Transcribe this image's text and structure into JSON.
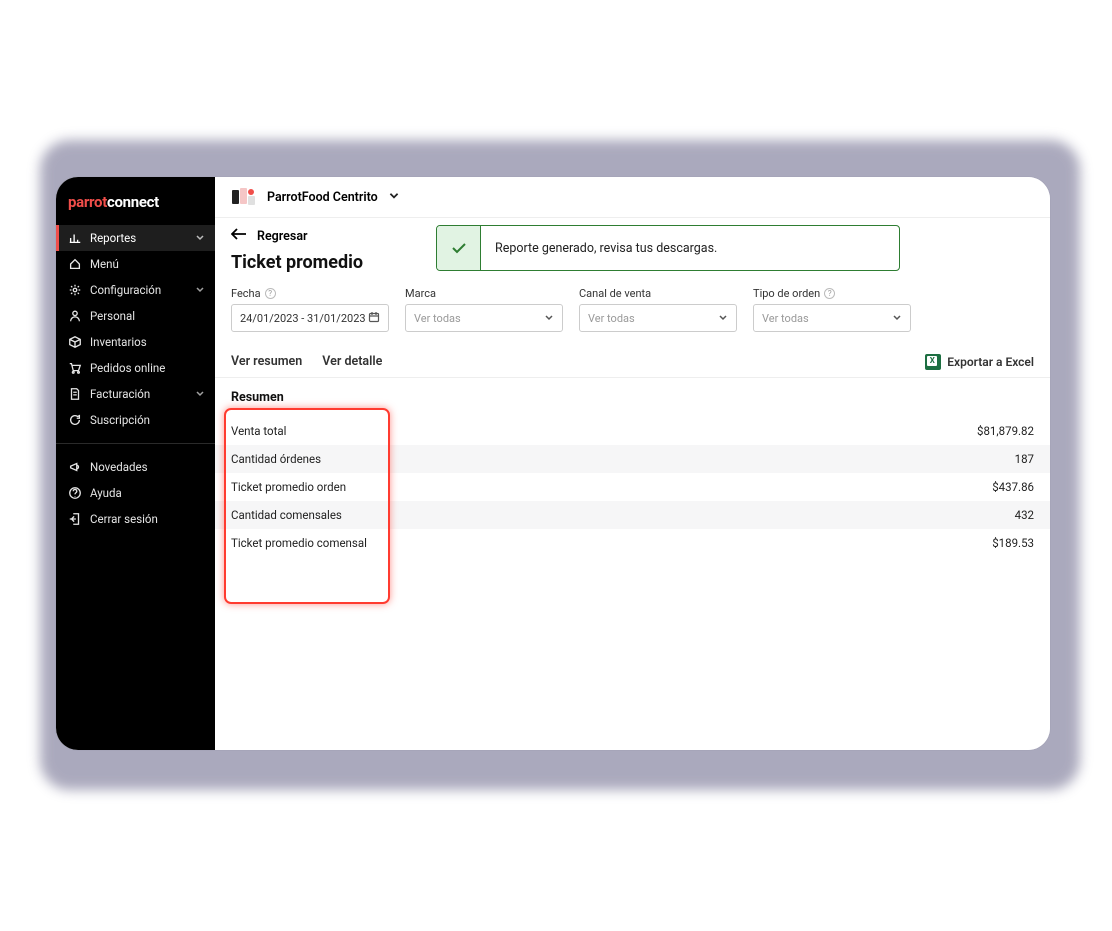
{
  "brand": {
    "part1": "parrot",
    "part2": "connect"
  },
  "sidebar": {
    "items": [
      {
        "label": "Reportes",
        "expandable": true,
        "active": true
      },
      {
        "label": "Menú",
        "expandable": false
      },
      {
        "label": "Configuración",
        "expandable": true
      },
      {
        "label": "Personal",
        "expandable": false
      },
      {
        "label": "Inventarios",
        "expandable": false
      },
      {
        "label": "Pedidos online",
        "expandable": false
      },
      {
        "label": "Facturación",
        "expandable": true
      },
      {
        "label": "Suscripción",
        "expandable": false
      }
    ],
    "footer": [
      {
        "label": "Novedades"
      },
      {
        "label": "Ayuda"
      },
      {
        "label": "Cerrar sesión"
      }
    ]
  },
  "topbar": {
    "location": "ParrotFood Centrito"
  },
  "back": {
    "label": "Regresar"
  },
  "alert": {
    "message": "Reporte generado, revisa tus descargas."
  },
  "page": {
    "title": "Ticket promedio"
  },
  "filters": {
    "fecha": {
      "label": "Fecha",
      "value": "24/01/2023 - 31/01/2023",
      "help": true
    },
    "marca": {
      "label": "Marca",
      "placeholder": "Ver todas"
    },
    "canal": {
      "label": "Canal de venta",
      "placeholder": "Ver todas"
    },
    "tipo": {
      "label": "Tipo de orden",
      "placeholder": "Ver todas",
      "help": true
    }
  },
  "tabs": {
    "resumen": "Ver resumen",
    "detalle": "Ver detalle",
    "export": "Exportar a Excel"
  },
  "summary": {
    "heading": "Resumen",
    "rows": [
      {
        "label": "Venta total",
        "value": "$81,879.82"
      },
      {
        "label": "Cantidad órdenes",
        "value": "187"
      },
      {
        "label": "Ticket promedio orden",
        "value": "$437.86"
      },
      {
        "label": "Cantidad comensales",
        "value": "432"
      },
      {
        "label": "Ticket promedio comensal",
        "value": "$189.53"
      }
    ]
  }
}
